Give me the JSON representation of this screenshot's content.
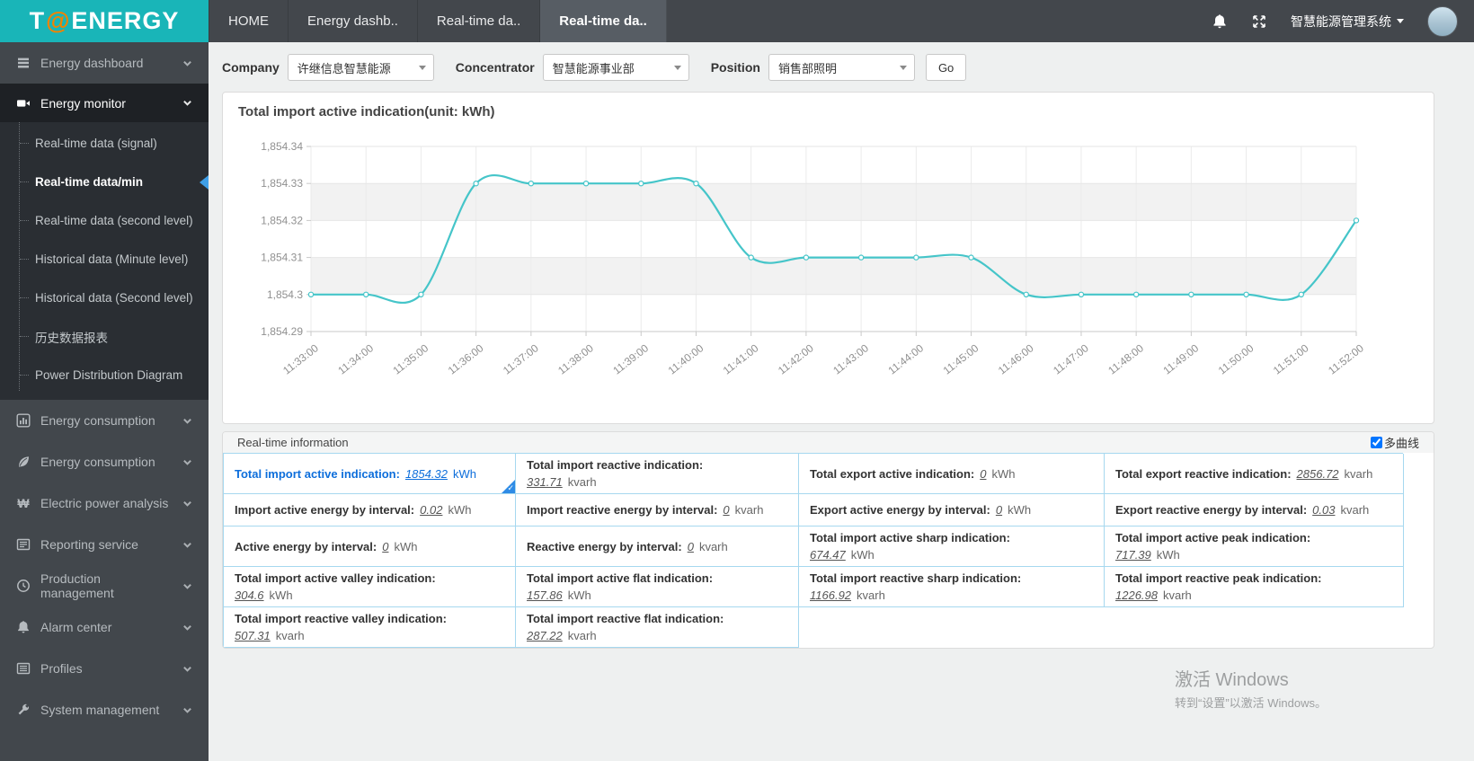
{
  "topbar": {
    "logo": {
      "part1": "T",
      "at": "@",
      "part2": "ENERGY"
    },
    "tabs": [
      {
        "label": "HOME"
      },
      {
        "label": "Energy dashb.."
      },
      {
        "label": "Real-time da.."
      },
      {
        "label": "Real-time da.."
      }
    ],
    "system_name": "智慧能源管理系统"
  },
  "sidebar": {
    "items": [
      {
        "label": "Energy dashboard",
        "icon": "dashboard-icon"
      },
      {
        "label": "Energy monitor",
        "icon": "video-camera-icon"
      }
    ],
    "submenu": [
      {
        "label": "Real-time data (signal)"
      },
      {
        "label": "Real-time data/min",
        "active": true
      },
      {
        "label": "Real-time data (second level)"
      },
      {
        "label": "Historical data (Minute level)"
      },
      {
        "label": "Historical data (Second level)"
      },
      {
        "label": "历史数据报表"
      },
      {
        "label": "Power Distribution Diagram"
      }
    ],
    "lower": [
      {
        "label": "Energy consumption",
        "icon": "bar-chart-icon"
      },
      {
        "label": "Energy consumption",
        "icon": "leaf-icon"
      },
      {
        "label": "Electric power analysis",
        "icon": "won-icon",
        "won_glyph": "₩"
      },
      {
        "label": "Reporting service",
        "icon": "report-icon"
      },
      {
        "label": "Production management",
        "icon": "clock-icon"
      },
      {
        "label": "Alarm center",
        "icon": "bell-icon"
      },
      {
        "label": "Profiles",
        "icon": "list-icon"
      },
      {
        "label": "System management",
        "icon": "wrench-icon"
      }
    ]
  },
  "filters": {
    "company_label": "Company",
    "company_value": "许继信息智慧能源",
    "concentrator_label": "Concentrator",
    "concentrator_value": "智慧能源事业部",
    "position_label": "Position",
    "position_value": "销售部照明",
    "go_label": "Go"
  },
  "chart_data": {
    "type": "line",
    "title": "Total import active indication(unit:  kWh)",
    "x": [
      "11:33:00",
      "11:34:00",
      "11:35:00",
      "11:36:00",
      "11:37:00",
      "11:38:00",
      "11:39:00",
      "11:40:00",
      "11:41:00",
      "11:42:00",
      "11:43:00",
      "11:44:00",
      "11:45:00",
      "11:46:00",
      "11:47:00",
      "11:48:00",
      "11:49:00",
      "11:50:00",
      "11:51:00",
      "11:52:00"
    ],
    "series": [
      {
        "name": "Total import active indication",
        "values": [
          1854.3,
          1854.3,
          1854.3,
          1854.33,
          1854.33,
          1854.33,
          1854.33,
          1854.33,
          1854.31,
          1854.31,
          1854.31,
          1854.31,
          1854.31,
          1854.3,
          1854.3,
          1854.3,
          1854.3,
          1854.3,
          1854.3,
          1854.32
        ]
      }
    ],
    "ylim": [
      1854.29,
      1854.34
    ],
    "yticks": [
      {
        "v": 1854.29,
        "label": "1,854.29"
      },
      {
        "v": 1854.3,
        "label": "1,854.3"
      },
      {
        "v": 1854.31,
        "label": "1,854.31"
      },
      {
        "v": 1854.32,
        "label": "1,854.32"
      },
      {
        "v": 1854.33,
        "label": "1,854.33"
      },
      {
        "v": 1854.34,
        "label": "1,854.34"
      }
    ],
    "smooth": true,
    "grid": true,
    "legend_position": "none",
    "line_color": "#45c5c9",
    "band_color": "#f2f2f2"
  },
  "info": {
    "title": "Real-time information",
    "multi_curve_label": "多曲线",
    "multi_curve_checked": true,
    "rows": [
      {
        "cells": [
          {
            "label": "Total import active indication:",
            "value": "1854.32",
            "unit": "kWh",
            "selected": true
          },
          {
            "label": "Total import reactive indication:",
            "value": "331.71",
            "unit": "kvarh"
          },
          {
            "label": "Total export active indication:",
            "value": "0",
            "unit": "kWh"
          },
          {
            "label": "Total export reactive indication:",
            "value": "2856.72",
            "unit": "kvarh"
          }
        ]
      },
      {
        "cells": [
          {
            "label": "Import active energy by interval:",
            "value": "0.02",
            "unit": "kWh"
          },
          {
            "label": "Import reactive energy by interval:",
            "value": "0",
            "unit": "kvarh"
          },
          {
            "label": "Export active energy by interval:",
            "value": "0",
            "unit": "kWh"
          },
          {
            "label": "Export reactive energy by interval:",
            "value": "0.03",
            "unit": "kvarh"
          }
        ]
      },
      {
        "cells": [
          {
            "label": "Active energy by interval:",
            "value": "0",
            "unit": "kWh"
          },
          {
            "label": "Reactive energy by interval:",
            "value": "0",
            "unit": "kvarh"
          },
          {
            "label": "Total import active sharp indication:",
            "value": "674.47",
            "unit": "kWh"
          },
          {
            "label": "Total import active peak indication:",
            "value": "717.39",
            "unit": "kWh"
          }
        ]
      },
      {
        "cells": [
          {
            "label": "Total import active valley indication:",
            "value": "304.6",
            "unit": "kWh"
          },
          {
            "label": "Total import active flat indication:",
            "value": "157.86",
            "unit": "kWh"
          },
          {
            "label": "Total import reactive sharp indication:",
            "value": "1166.92",
            "unit": "kvarh"
          },
          {
            "label": "Total import reactive peak indication:",
            "value": "1226.98",
            "unit": "kvarh"
          }
        ]
      },
      {
        "cells": [
          {
            "label": "Total import reactive valley indication:",
            "value": "507.31",
            "unit": "kvarh"
          },
          {
            "label": "Total import reactive flat indication:",
            "value": "287.22",
            "unit": "kvarh"
          }
        ]
      }
    ]
  },
  "watermark": {
    "line1": "激活 Windows",
    "line2": "转到“设置”以激活 Windows。"
  }
}
